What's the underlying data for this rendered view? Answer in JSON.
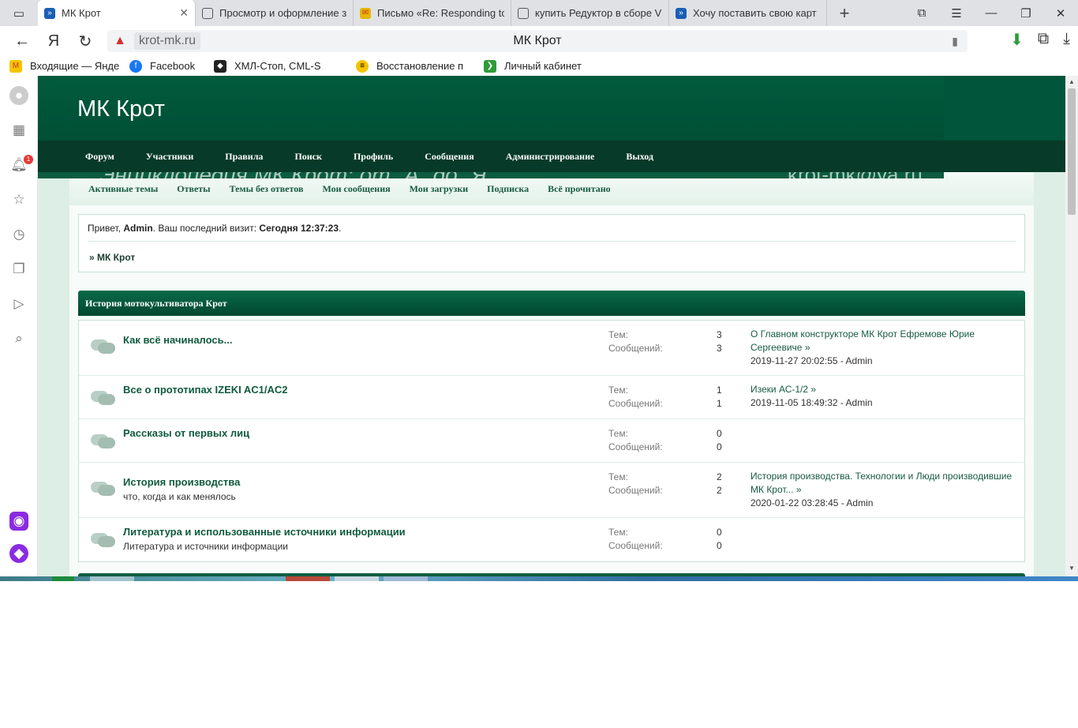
{
  "browser": {
    "tabs": [
      {
        "label": "МК Крот",
        "active": true
      },
      {
        "label": "Просмотр и оформление з"
      },
      {
        "label": "Письмо «Re: Responding to"
      },
      {
        "label": "купить Редуктор в сборе V"
      },
      {
        "label": "Хочу поставить свою карт"
      }
    ],
    "new_tab": "+",
    "address": {
      "domain": "krot-mk.ru",
      "title": "МК Крот"
    },
    "bookmarks": [
      {
        "label": "Входящие — Янде"
      },
      {
        "label": "Facebook"
      },
      {
        "label": "ХМЛ-Стоп, CML-S"
      },
      {
        "label": "Восстановление п"
      },
      {
        "label": "Личный кабинет"
      }
    ],
    "sidebar_badge": "1"
  },
  "site": {
    "title": "МК Крот",
    "nav": [
      "Форум",
      "Участники",
      "Правила",
      "Поиск",
      "Профиль",
      "Сообщения",
      "Администрирование",
      "Выход"
    ],
    "slogan": "Энциклопедия МК Крот: от \"А\" до \"Я\"",
    "email": "krot-mk@ya.ru",
    "subnav": [
      "Активные темы",
      "Ответы",
      "Темы без ответов",
      "Мои сообщения",
      "Мои загрузки",
      "Подписка",
      "Всё прочитано"
    ]
  },
  "welcome": {
    "greeting": "Привет, ",
    "user": "Admin",
    "visit_label": ". Ваш последний визит: ",
    "visit_time": "Сегодня 12:37:23",
    "visit_end": ".",
    "breadcrumb": "» МК Крот"
  },
  "category": {
    "title": "История мотокультиватора Крот",
    "labels": {
      "topics": "Тем:",
      "posts": "Сообщений:"
    },
    "boards": [
      {
        "name": "Как всё начиналось...",
        "desc": "",
        "topics": "3",
        "posts": "3",
        "last_title": "О Главном конструкторе МК Крот Ефремове Юрие Сергеевиче »",
        "last_meta": "2019-11-27 20:02:55 - Admin"
      },
      {
        "name": "Все о прототипах IZEKI AC1/AC2",
        "desc": "",
        "topics": "1",
        "posts": "1",
        "last_title": "Изеки АС-1/2 »",
        "last_meta": "2019-11-05 18:49:32 - Admin"
      },
      {
        "name": "Рассказы от первых лиц",
        "desc": "",
        "topics": "0",
        "posts": "0",
        "last_title": "",
        "last_meta": ""
      },
      {
        "name": "История производства",
        "desc": "что, когда и как менялось",
        "topics": "2",
        "posts": "2",
        "last_title": "История производства. Технологии и Люди производившие МК Крот... »",
        "last_meta": "2020-01-22 03:28:45 - Admin"
      },
      {
        "name": "Литература и использованные источники информации",
        "desc": "Литература и источники информации",
        "topics": "0",
        "posts": "0",
        "last_title": "",
        "last_meta": ""
      }
    ]
  },
  "colors": {
    "brand_green": "#00553a",
    "nav_dark": "#073a28",
    "link": "#0f5a3e",
    "page_bg": "#ddeee6"
  }
}
